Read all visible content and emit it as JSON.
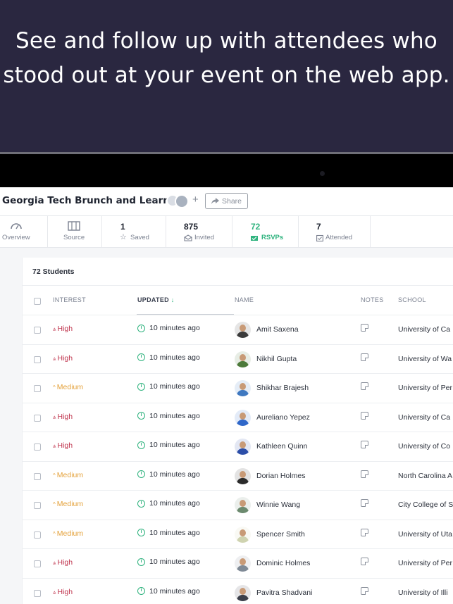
{
  "hero": {
    "line1": "See and follow up with attendees who",
    "line2": "stood out at your event on the web app."
  },
  "event": {
    "title": "Georgia Tech Brunch and Learn",
    "more_label": "···",
    "add_label": "+",
    "share_label": "Share"
  },
  "stats": [
    {
      "value": "",
      "label": "Overview",
      "icon": "gauge-icon"
    },
    {
      "value": "",
      "label": "Source",
      "icon": "book-icon"
    },
    {
      "value": "1",
      "label": "Saved",
      "icon": "star-icon"
    },
    {
      "value": "875",
      "label": "Invited",
      "icon": "invite-icon"
    },
    {
      "value": "72",
      "label": "RSVPs",
      "icon": "rsvp-icon"
    },
    {
      "value": "7",
      "label": "Attended",
      "icon": "calendar-check-icon"
    }
  ],
  "table": {
    "title": "72 Students",
    "columns": {
      "interest": "INTEREST",
      "updated": "UPDATED",
      "name": "NAME",
      "notes": "NOTES",
      "school": "SCHOOL"
    },
    "rows": [
      {
        "interest": "High",
        "level": "high",
        "updated": "10 minutes ago",
        "name": "Amit Saxena",
        "school": "University of Ca"
      },
      {
        "interest": "High",
        "level": "high",
        "updated": "10 minutes ago",
        "name": "Nikhil Gupta",
        "school": "University of Wa"
      },
      {
        "interest": "Medium",
        "level": "medium",
        "updated": "10 minutes ago",
        "name": "Shikhar Brajesh",
        "school": "University of Per"
      },
      {
        "interest": "High",
        "level": "high",
        "updated": "10 minutes ago",
        "name": "Aureliano Yepez",
        "school": "University of Ca"
      },
      {
        "interest": "High",
        "level": "high",
        "updated": "10 minutes ago",
        "name": "Kathleen Quinn",
        "school": "University of Co"
      },
      {
        "interest": "Medium",
        "level": "medium",
        "updated": "10 minutes ago",
        "name": "Dorian Holmes",
        "school": "North Carolina A"
      },
      {
        "interest": "Medium",
        "level": "medium",
        "updated": "10 minutes ago",
        "name": "Winnie Wang",
        "school": "City College of S"
      },
      {
        "interest": "Medium",
        "level": "medium",
        "updated": "10 minutes ago",
        "name": "Spencer Smith",
        "school": "University of Uta"
      },
      {
        "interest": "High",
        "level": "high",
        "updated": "10 minutes ago",
        "name": "Dominic Holmes",
        "school": "University of Per"
      },
      {
        "interest": "High",
        "level": "high",
        "updated": "10 minutes ago",
        "name": "Pavitra Shadvani",
        "school": "University of Illi"
      }
    ]
  },
  "colors": {
    "hero_bg": "#2a2740",
    "high": "#c0364f",
    "medium": "#e4a13a",
    "accent_green": "#2fb37e"
  }
}
